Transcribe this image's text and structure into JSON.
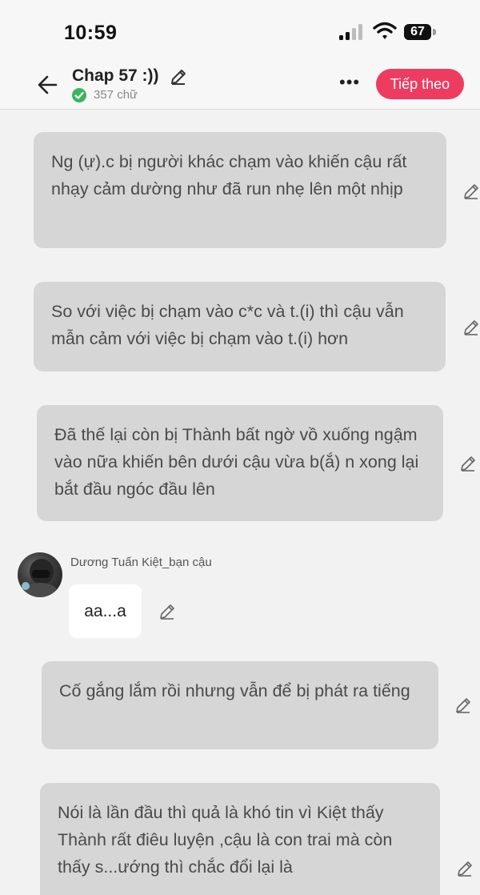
{
  "status_bar": {
    "time": "10:59",
    "battery": "67"
  },
  "header": {
    "title": "Chap 57 :))",
    "word_count": "357 chữ",
    "next_label": "Tiếp theo",
    "more_label": "•••",
    "accent_color": "#ee3c61"
  },
  "messages": [
    {
      "text": "Ng (ự).c bị người khác chạm vào khiến cậu rất nhạy cảm dường như đã run nhẹ lên một nhịp"
    },
    {
      "text": "So với việc bị chạm vào c*c và t.(i) thì cậu vẫn mẫn cảm với việc bị chạm vào t.(i) hơn"
    },
    {
      "text": "Đã thế lại còn bị Thành bất ngờ vồ xuống ngậm vào nữa khiến bên dưới cậu vừa b(ắ) n xong lại bắt đầu ngóc đầu lên"
    },
    {
      "text": "Cố gắng lắm rồi nhưng vẫn để bị phát ra tiếng"
    },
    {
      "text": "Nói là lần đầu thì quả là khó tin vì Kiệt thấy Thành rất điêu luyện ,cậu là con trai mà còn thấy s...ướng thì chắc đổi lại là"
    }
  ],
  "character_message": {
    "name": "Dương Tuấn Kiệt_bạn cậu",
    "text": "aa...a"
  }
}
